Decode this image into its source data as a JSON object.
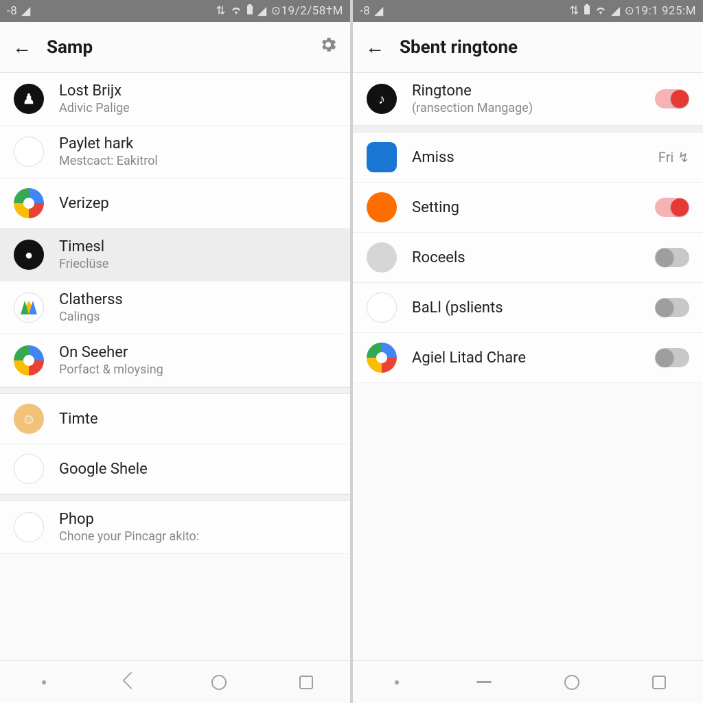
{
  "left": {
    "status": {
      "temp": "-8",
      "time": "19/2/58†M"
    },
    "appbar": {
      "title": "Samp"
    },
    "items": [
      {
        "name": "item-lostbrijx",
        "primary": "Lost Brijx",
        "secondary": "Adivic Palige",
        "icon": "ghost",
        "iconClass": "ic-black"
      },
      {
        "name": "item-paylet",
        "primary": "Paylet hark",
        "secondary": "Mestcact: Eakitrol",
        "icon": "key",
        "iconClass": "ic-white"
      },
      {
        "name": "item-verizep",
        "primary": "Verizep",
        "secondary": "",
        "icon": "ring",
        "iconClass": "wheel"
      },
      {
        "name": "item-timesl",
        "primary": "Timesl",
        "secondary": "Frieclüse",
        "icon": "dot",
        "iconClass": "ic-black",
        "selected": true
      },
      {
        "name": "item-clatherss",
        "primary": "Clatherss",
        "secondary": "Calings",
        "icon": "drive",
        "iconClass": ""
      },
      {
        "name": "item-onseeher",
        "primary": "On Seeher",
        "secondary": "Porfact & mloysing",
        "icon": "wheel",
        "iconClass": "wheel"
      }
    ],
    "items2": [
      {
        "name": "item-timte",
        "primary": "Timte",
        "secondary": "",
        "icon": "face",
        "iconClass": "ic-face"
      },
      {
        "name": "item-google",
        "primary": "Google Shele",
        "secondary": "",
        "icon": "C",
        "iconClass": "ic-cyan"
      }
    ],
    "items3": [
      {
        "name": "item-phop",
        "primary": "Phop",
        "secondary": "Chone your Pincagr akito:",
        "icon": "play",
        "iconClass": "ic-play"
      }
    ]
  },
  "right": {
    "status": {
      "temp": "-8",
      "time": "19:1 925:M"
    },
    "appbar": {
      "title": "Sbent ringtone"
    },
    "header": {
      "name": "item-ringtone",
      "primary": "Ringtone",
      "secondary": "(ransection Mangage)",
      "iconClass": "ic-black",
      "toggle": true
    },
    "items": [
      {
        "name": "item-amiss",
        "primary": "Amiss",
        "iconShape": "sq",
        "iconClass": "ic-blue",
        "trail": "Fri",
        "trailIcon": "↯"
      },
      {
        "name": "item-setting",
        "primary": "Setting",
        "iconClass": "ic-orange",
        "toggle": true
      },
      {
        "name": "item-roceels",
        "primary": "Roceels",
        "iconClass": "ic-grey",
        "toggle": false
      },
      {
        "name": "item-bal",
        "primary": "BaLl (pslients",
        "iconClass": "ic-green",
        "toggle": false
      },
      {
        "name": "item-agiel",
        "primary": "Agiel Litad Chare",
        "iconClass": "wheel",
        "toggle": false
      }
    ]
  }
}
